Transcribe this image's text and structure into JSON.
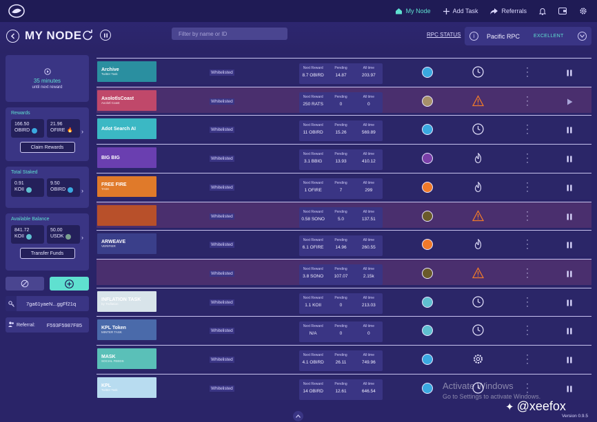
{
  "topnav": {
    "my_node": "My Node",
    "add_task": "Add Task",
    "referrals": "Referrals"
  },
  "header": {
    "title": "MY NODE",
    "search_placeholder": "Filter by name or ID",
    "rpc_status_link": "RPC STATUS",
    "rpc_name": "Pacific RPC",
    "rpc_quality": "EXCELLENT"
  },
  "sidebar": {
    "timer_value": "35 minutes",
    "timer_sub": "until next reward",
    "rewards": {
      "label": "Rewards",
      "a_amount": "166.50",
      "a_token": "OBIRD",
      "b_amount": "21.96",
      "b_token": "OFIRE",
      "button": "Claim Rewards"
    },
    "staked": {
      "label": "Total Staked",
      "a_amount": "0.91",
      "a_token": "KOII",
      "b_amount": "9.50",
      "b_token": "OBIRD"
    },
    "balance": {
      "label": "Available Balance",
      "a_amount": "841.72",
      "a_token": "KOII",
      "b_amount": "50.00",
      "b_token": "USDK",
      "button": "Transfer Funds"
    },
    "key": "7ga61yaeN...ggFf21q",
    "referral_label": "Referral:",
    "referral_code": "F593F5987F85"
  },
  "columns": {
    "next_reward": "Next Reward",
    "pending": "Pending",
    "all_time": "All time"
  },
  "tasks": [
    {
      "banner": "Archive",
      "banner_sub": "Twitter Task",
      "status": "Whitelisted",
      "next_reward": "8.7 OBIRD",
      "pending": "14.87",
      "all_time": "203.97",
      "state": "clock",
      "control": "pause",
      "bg": "#2a8fa0",
      "token_color": "#3aa9e0",
      "warn": false
    },
    {
      "banner": "AxolotlsCoast",
      "banner_sub": "Axolotl Coast",
      "status": "Whitelisted",
      "next_reward": "250 RATS",
      "pending": "0",
      "all_time": "0",
      "state": "warning",
      "control": "play",
      "bg": "#c0486a",
      "token_color": "#a7906a",
      "warn": true
    },
    {
      "banner": "Adot Search AI",
      "banner_sub": "",
      "status": "Whitelisted",
      "next_reward": "11 OBIRD",
      "pending": "15.26",
      "all_time": "569.89",
      "state": "clock",
      "control": "pause",
      "bg": "#3bb8c4",
      "token_color": "#3aa9e0",
      "warn": false
    },
    {
      "banner": "BIG BIG",
      "banner_sub": "",
      "status": "Whitelisted",
      "next_reward": "3.1 BBIG",
      "pending": "13.93",
      "all_time": "410.12",
      "state": "flame",
      "control": "pause",
      "bg": "#6a3fb0",
      "token_color": "#7a3fa8",
      "warn": false
    },
    {
      "banner": "FREE FIRE",
      "banner_sub": "TASK",
      "status": "Whitelisted",
      "next_reward": "1 OFIRE",
      "pending": "7",
      "all_time": "299",
      "state": "flame",
      "control": "pause",
      "bg": "#e07a2a",
      "token_color": "#f07a2a",
      "warn": false
    },
    {
      "banner": "",
      "banner_sub": "",
      "status": "Whitelisted",
      "next_reward": "0.58 SONO",
      "pending": "5.0",
      "all_time": "137.51",
      "state": "warning",
      "control": "pause",
      "bg": "#b8502a",
      "token_color": "#6a5a2a",
      "warn": true
    },
    {
      "banner": "ARWEAVE",
      "banner_sub": "VERIFIER",
      "status": "Whitelisted",
      "next_reward": "6.1 OFIRE",
      "pending": "14.96",
      "all_time": "260.55",
      "state": "flame",
      "control": "pause",
      "bg": "#3a3f8a",
      "token_color": "#f07a2a",
      "warn": false
    },
    {
      "banner": "",
      "banner_sub": "",
      "status": "Whitelisted",
      "next_reward": "3.8 SONO",
      "pending": "107.07",
      "all_time": "2.15k",
      "state": "warning",
      "control": "pause",
      "bg": "#4a2f6e",
      "token_color": "#6a5a2a",
      "warn": true
    },
    {
      "banner": "INFLATION TASK",
      "banner_sub": "by Truflation",
      "status": "Whitelisted",
      "next_reward": "1.1 KOII",
      "pending": "0",
      "all_time": "213.03",
      "state": "clock",
      "control": "pause",
      "bg": "#d8e4ea",
      "token_color": "#5fc0d0",
      "warn": false
    },
    {
      "banner": "KPL Token",
      "banner_sub": "MINTER TASK",
      "status": "Whitelisted",
      "next_reward": "N/A",
      "pending": "0",
      "all_time": "0",
      "state": "clock",
      "control": "pause",
      "bg": "#4a6aaa",
      "token_color": "#5fc0d0",
      "warn": false
    },
    {
      "banner": "MASK",
      "banner_sub": "SOCIAL FEEDS",
      "status": "Whitelisted",
      "next_reward": "4.1 OBIRD",
      "pending": "26.11",
      "all_time": "749.96",
      "state": "gear",
      "control": "pause",
      "bg": "#5ac0b8",
      "token_color": "#3aa9e0",
      "warn": false
    },
    {
      "banner": "KPL",
      "banner_sub": "Twitter Task",
      "status": "Whitelisted",
      "next_reward": "14 OBIRD",
      "pending": "12.61",
      "all_time": "646.54",
      "state": "clock",
      "control": "pause",
      "bg": "#b8dcf0",
      "token_color": "#3aa9e0",
      "warn": false
    }
  ],
  "overlay": {
    "activate_title": "Activate Windows",
    "activate_sub": "Go to Settings to activate Windows.",
    "watermark": "@xeefox",
    "version": "Version 0.9.5"
  }
}
